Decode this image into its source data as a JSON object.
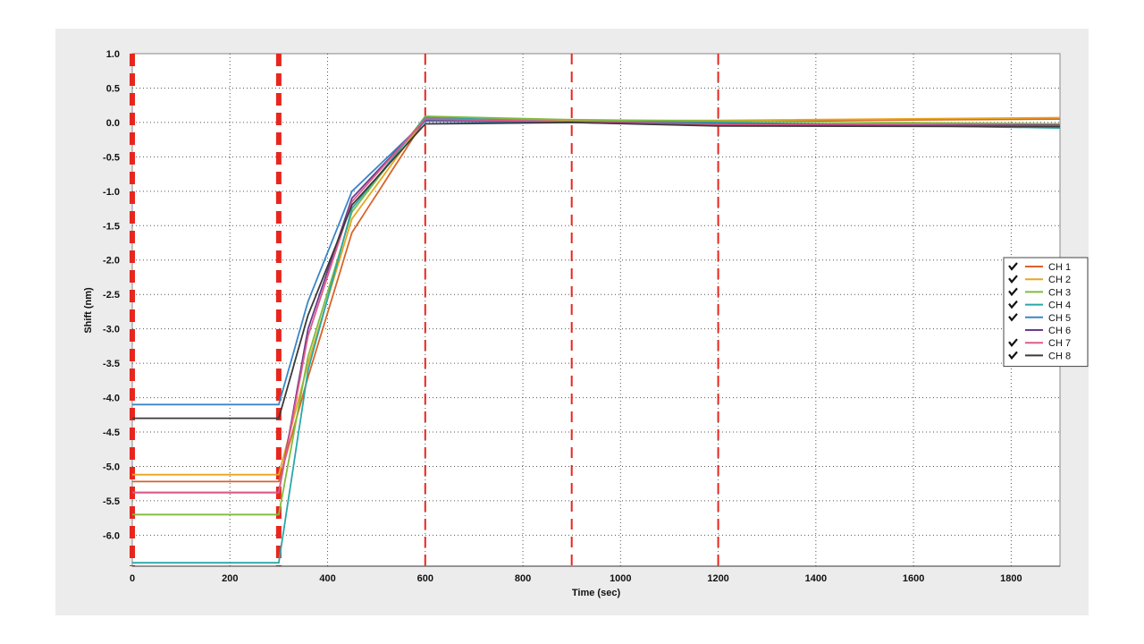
{
  "chart_data": {
    "type": "line",
    "xlabel": "Time (sec)",
    "ylabel": "Shift (nm)",
    "xlim": [
      0,
      1900
    ],
    "ylim": [
      -6.45,
      1.0
    ],
    "x_ticks": [
      0,
      200,
      400,
      600,
      800,
      1000,
      1200,
      1400,
      1600,
      1800
    ],
    "y_ticks": [
      1.0,
      0.5,
      0.0,
      -0.5,
      -1.0,
      -1.5,
      -2.0,
      -2.5,
      -3.0,
      -3.5,
      -4.0,
      -4.5,
      -5.0,
      -5.5,
      -6.0
    ],
    "grid": true,
    "legend_position": "right",
    "event_lines": [
      {
        "x": 0,
        "style": "thick-dashed",
        "color": "#e8261e"
      },
      {
        "x": 300,
        "style": "thick-dashed",
        "color": "#e8261e"
      },
      {
        "x": 600,
        "style": "dashed",
        "color": "#e8261e"
      },
      {
        "x": 900,
        "style": "dashed",
        "color": "#e8261e"
      },
      {
        "x": 1200,
        "style": "dashed",
        "color": "#e8261e"
      }
    ],
    "series": [
      {
        "name": "CH 1",
        "color": "#d8632a",
        "checked": true,
        "x": [
          0,
          300,
          360,
          450,
          600,
          900,
          1200,
          1900
        ],
        "y": [
          -5.22,
          -5.22,
          -3.7,
          -1.6,
          0.05,
          0.02,
          0.02,
          0.05
        ]
      },
      {
        "name": "CH 2",
        "color": "#e9a520",
        "checked": true,
        "x": [
          0,
          300,
          360,
          450,
          600,
          900,
          1200,
          1900
        ],
        "y": [
          -5.12,
          -5.12,
          -3.5,
          -1.4,
          0.06,
          0.03,
          0.03,
          0.07
        ]
      },
      {
        "name": "CH 3",
        "color": "#80bc3c",
        "checked": true,
        "x": [
          0,
          300,
          360,
          450,
          600,
          900,
          1200,
          1900
        ],
        "y": [
          -5.7,
          -5.7,
          -3.4,
          -1.3,
          0.09,
          0.04,
          0.02,
          -0.02
        ]
      },
      {
        "name": "CH 4",
        "color": "#2aa7a8",
        "checked": true,
        "x": [
          0,
          300,
          360,
          450,
          600,
          900,
          1200,
          1900
        ],
        "y": [
          -6.4,
          -6.4,
          -3.6,
          -1.25,
          0.07,
          0.01,
          0.0,
          -0.08
        ]
      },
      {
        "name": "CH 5",
        "color": "#3a86c8",
        "checked": true,
        "x": [
          0,
          300,
          360,
          450,
          600,
          900,
          1200,
          1900
        ],
        "y": [
          -4.1,
          -4.1,
          -2.6,
          -1.0,
          0.02,
          0.0,
          -0.04,
          -0.06
        ]
      },
      {
        "name": "CH 6",
        "color": "#6a3a8e",
        "checked": false,
        "x": [
          0,
          300,
          360,
          450,
          600,
          900,
          1200,
          1900
        ],
        "y": [
          -5.38,
          -5.38,
          -3.0,
          -1.1,
          0.04,
          0.01,
          -0.02,
          -0.04
        ]
      },
      {
        "name": "CH 7",
        "color": "#e05a8a",
        "checked": true,
        "x": [
          0,
          300,
          360,
          450,
          600,
          900,
          1200,
          1900
        ],
        "y": [
          -5.38,
          -5.38,
          -3.1,
          -1.15,
          0.05,
          0.01,
          -0.03,
          -0.05
        ]
      },
      {
        "name": "CH 8",
        "color": "#3a3a3a",
        "checked": true,
        "x": [
          0,
          300,
          360,
          450,
          600,
          900,
          1200,
          1900
        ],
        "y": [
          -4.3,
          -4.3,
          -2.8,
          -1.2,
          -0.02,
          0.0,
          -0.05,
          -0.06
        ]
      }
    ]
  }
}
